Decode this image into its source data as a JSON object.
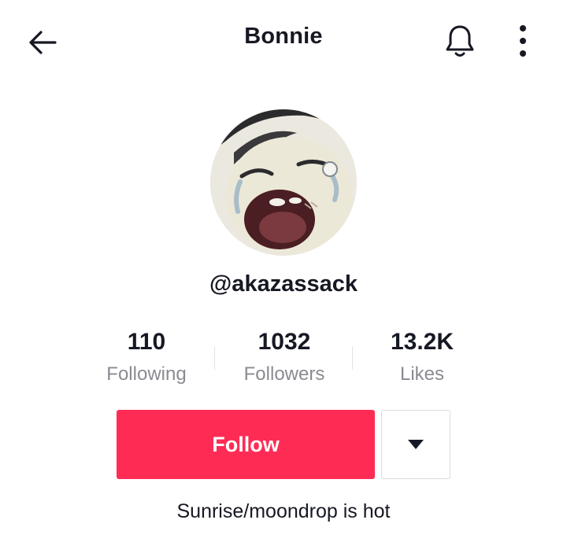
{
  "header": {
    "title": "Bonnie",
    "back_icon": "arrow-left-icon",
    "bell_icon": "bell-icon",
    "more_icon": "more-vertical-icon"
  },
  "profile": {
    "avatar": "avatar",
    "username": "@akazassack"
  },
  "stats": [
    {
      "value": "110",
      "label": "Following"
    },
    {
      "value": "1032",
      "label": "Followers"
    },
    {
      "value": "13.2K",
      "label": "Likes"
    }
  ],
  "actions": {
    "follow_label": "Follow",
    "dropdown_icon": "caret-down-icon"
  },
  "bio": "Sunrise/moondrop is hot",
  "colors": {
    "accent": "#fe2c55",
    "text": "#161823",
    "muted": "#8a8b91"
  }
}
